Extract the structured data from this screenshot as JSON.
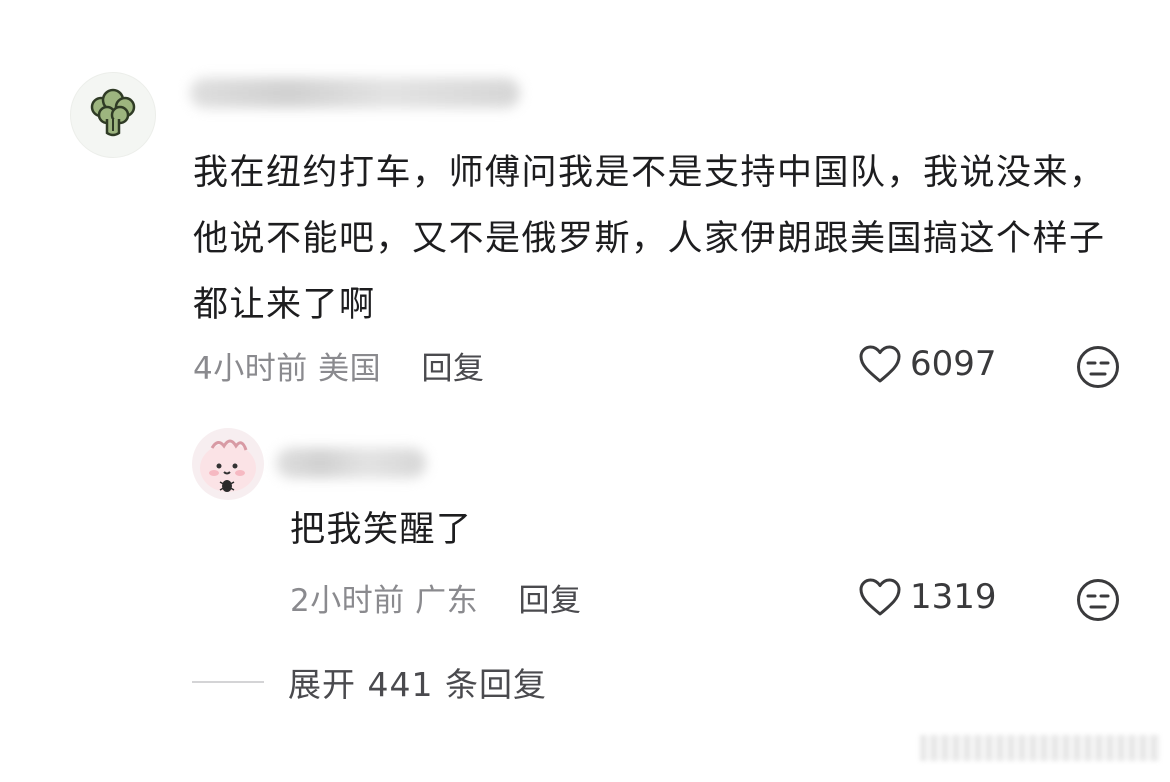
{
  "comment": {
    "text": "我在纽约打车，师傅问我是不是支持中国队，我说没来，他说不能吧，又不是俄罗斯，人家伊朗跟美国搞这个样子都让来了啊",
    "time": "4小时前",
    "location": "美国",
    "reply_label": "回复",
    "likes": "6097",
    "avatar_icon": "broccoli-icon"
  },
  "reply": {
    "text": "把我笑醒了",
    "time": "2小时前",
    "location": "广东",
    "reply_label": "回复",
    "likes": "1319",
    "avatar_icon": "cartoon-avatar-icon"
  },
  "expand_label": "展开 441 条回复",
  "colors": {
    "text": "#1d1d1f",
    "meta": "#8a8a8e",
    "icon": "#3a3a3c"
  }
}
